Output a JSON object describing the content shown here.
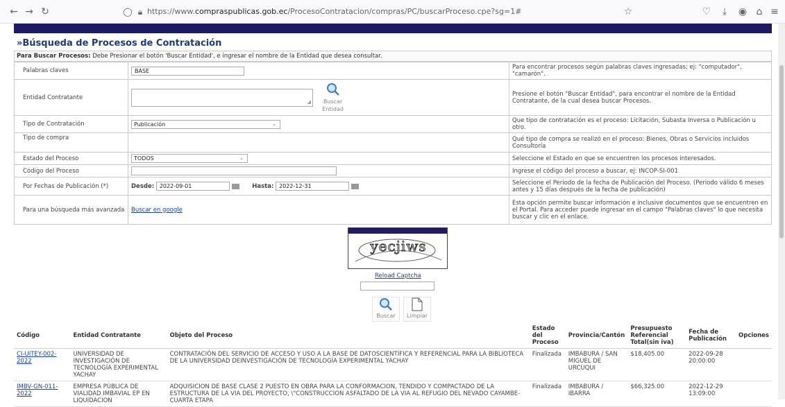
{
  "browser": {
    "url_prefix": "https://www.",
    "url_domain": "compraspublicas.gob.ec",
    "url_path": "/ProcesoContratacion/compras/PC/buscarProceso.cpe?sg=1#"
  },
  "page": {
    "title": "»Búsqueda de Procesos de Contratación",
    "instructions_bold": "Para Buscar Procesos:",
    "instructions": " Debe Presionar el botón 'Buscar Entidad', e ingresar el nombre de la Entidad que desea consultar."
  },
  "form": {
    "keywords_label": "Palabras claves",
    "keywords_value": "BASE",
    "keywords_help": "Para encontrar procesos según palabras claves ingresadas; ej: \"computador\", \"camarón\".",
    "entity_label": "Entidad Contratante",
    "entity_button": "Buscar Entidad",
    "entity_help": "Presione el botón \"Buscar Entidad\", para encontrar el nombre de la Entidad Contratante, de la cual desea buscar Procesos.",
    "type_label": "Tipo de Contratación",
    "type_value": "Publicación",
    "type_help": "Que tipo de contratación es el proceso: Licitación, Subasta Inversa o Publicación u otro.",
    "purchase_label": "Tipo de compra",
    "purchase_help": "Qué tipo de compra se realizó en el proceso: Bienes, Obras o Servicios incluidos Consultoría",
    "state_label": "Estado del Proceso",
    "state_value": "TODOS",
    "state_help": "Seleccione el Estado en que se encuentren los procesos interesados.",
    "code_label": "Código del Proceso",
    "code_help": "Ingrese el código del proceso a buscar, ej: INCOP-SI-001",
    "dates_label": "Por Fechas de Publicación (*)",
    "from_label": "Desde:",
    "from_value": "2022-09-01",
    "to_label": "Hasta:",
    "to_value": "2022-12-31",
    "dates_help": "Seleccione el Periodo de la fecha de Publicación del Proceso. (Periodo válido 6 meses antes y 15 días después de la fecha de publicación)",
    "advanced_label": "Para una búsqueda más avanzada",
    "advanced_link": "Buscar en google",
    "advanced_help": "Esta opción permite buscar información e inclusive documentos que se encuentren en el Portal. Para acceder puede ingresar en el campo \"Palabras claves\" lo que necesita buscar y clic en el enlace."
  },
  "captcha": {
    "text": "yecjiws",
    "reload": "Reload Captcha",
    "search_button": "Buscar",
    "clear_button": "Limpiar"
  },
  "results": {
    "headers": {
      "code": "Código",
      "entity": "Entidad Contratante",
      "object": "Objeto del Proceso",
      "state": "Estado del Proceso",
      "province": "Provincia/Cantón",
      "budget": "Presupuesto Referencial Total(sin iva)",
      "date": "Fecha de Publicación",
      "options": "Opciones"
    },
    "rows": [
      {
        "code": "CI-UITEY-002-2022",
        "entity": "UNIVERSIDAD DE INVESTIGACIÓN DE TECNOLOGÍA EXPERIMENTAL YACHAY",
        "object": "CONTRATACIÓN DEL SERVICIO DE ACCESO Y USO A LA BASE DE DATOSCIENTÍFICA Y REFERENCIAL PARA LA BIBLIOTECA DE LA UNIVERSIDAD DEINVESTIGACIÓN DE TECNOLOGÍA EXPERIMENTAL YACHAY",
        "state": "Finalizada",
        "province": "IMBABURA / SAN MIGUEL DE URCUQUI",
        "budget": "$18,405.00",
        "date": "2022-09-28 20:00:00"
      },
      {
        "code": "IMBV-GN-011-2022",
        "entity": "EMPRESA PÚBLICA DE VIALIDAD IMBAVIAL EP EN LIQUIDACION",
        "object": "ADQUISICION DE BASE CLASE 2 PUESTO EN OBRA PARA LA CONFORMACION, TENDIDO Y COMPACTADO DE LA ESTRUCTURA DE LA VIA DEL PROYECTO, \\\"CONSTRUCCION ASFALTADO DE LA VIA AL REFUGIO DEL NEVADO CAYAMBE- CUARTA ETAPA",
        "state": "Finalizada",
        "province": "IMBABURA / IBARRA",
        "budget": "$66,325.00",
        "date": "2022-12-29 13:09:00"
      }
    ]
  }
}
